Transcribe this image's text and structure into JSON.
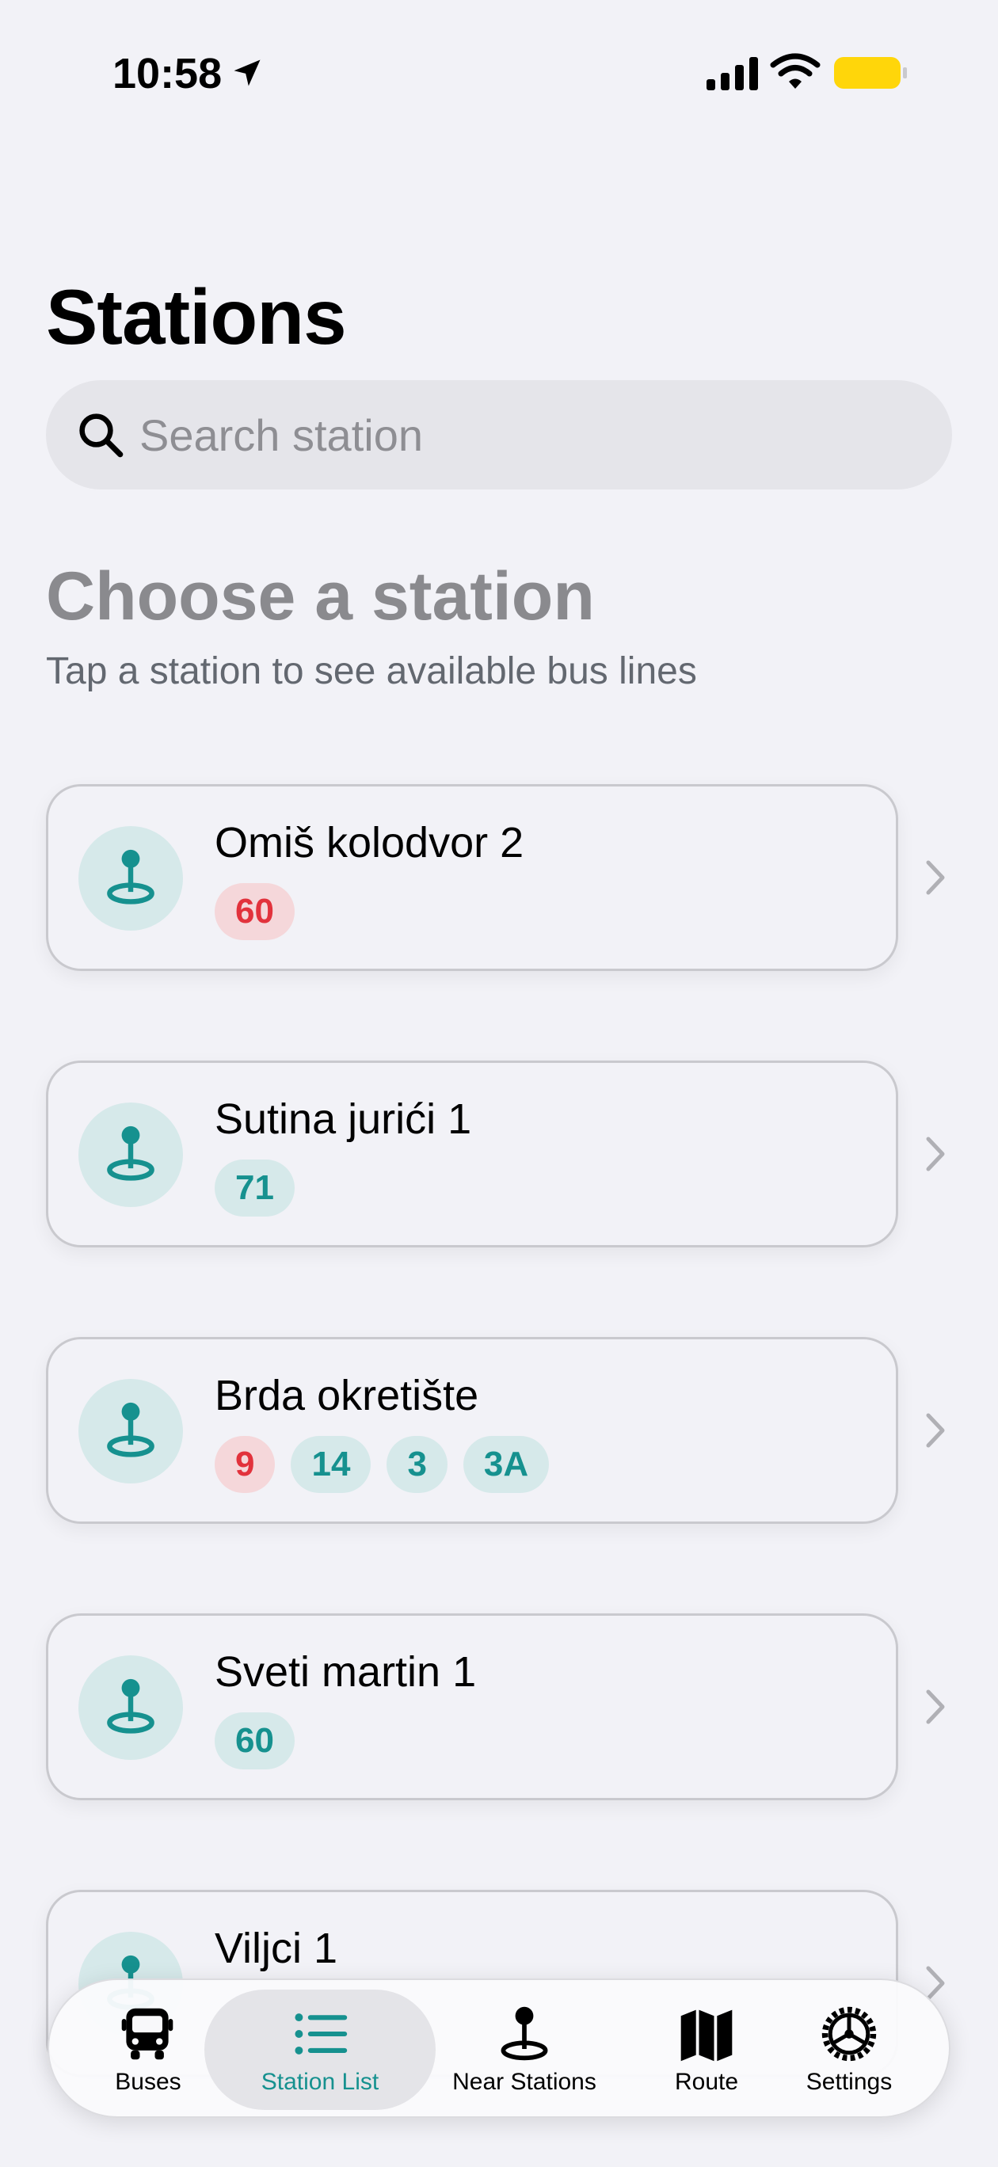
{
  "status": {
    "time": "10:58",
    "battery_color": "#ffd60a"
  },
  "title": "Stations",
  "search": {
    "placeholder": "Search station",
    "value": ""
  },
  "section": {
    "title": "Choose a station",
    "subtitle": "Tap a station to see available bus lines"
  },
  "stations": [
    {
      "name": "Omiš kolodvor 2",
      "lines": [
        {
          "label": "60",
          "color": "red"
        }
      ]
    },
    {
      "name": "Sutina jurići 1",
      "lines": [
        {
          "label": "71",
          "color": "teal"
        }
      ]
    },
    {
      "name": "Brda okretište",
      "lines": [
        {
          "label": "9",
          "color": "red"
        },
        {
          "label": "14",
          "color": "teal"
        },
        {
          "label": "3",
          "color": "teal"
        },
        {
          "label": "3A",
          "color": "teal"
        }
      ]
    },
    {
      "name": "Sveti martin 1",
      "lines": [
        {
          "label": "60",
          "color": "teal"
        }
      ]
    },
    {
      "name": "Viljci 1",
      "lines": []
    }
  ],
  "tabs": [
    {
      "label": "Buses",
      "icon": "bus-icon",
      "active": false
    },
    {
      "label": "Station List",
      "icon": "list-icon",
      "active": true
    },
    {
      "label": "Near Stations",
      "icon": "pin-icon",
      "active": false
    },
    {
      "label": "Route",
      "icon": "map-icon",
      "active": false
    },
    {
      "label": "Settings",
      "icon": "gear-icon",
      "active": false
    }
  ],
  "colors": {
    "accent": "#16918f",
    "badge_teal_bg": "#d6e9ea",
    "badge_red_bg": "#f5d7da",
    "badge_red_text": "#e2323c"
  }
}
